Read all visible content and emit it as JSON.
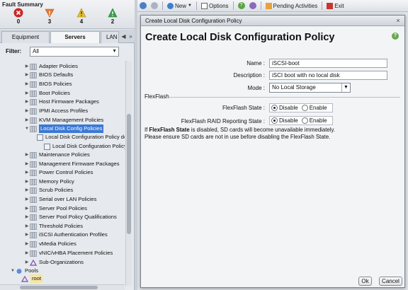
{
  "fault_summary": {
    "title": "Fault Summary",
    "counts": [
      {
        "name": "critical",
        "value": "0",
        "color": "#c62828"
      },
      {
        "name": "major",
        "value": "3",
        "color": "#e8772e"
      },
      {
        "name": "minor",
        "value": "4",
        "color": "#e6c02a"
      },
      {
        "name": "warning",
        "value": "2",
        "color": "#3aa04a"
      }
    ]
  },
  "nav_tabs": [
    "Equipment",
    "Servers",
    "LAN"
  ],
  "filter": {
    "label": "Filter:",
    "value": "All"
  },
  "tree": {
    "items": [
      "Adapter Policies",
      "BIOS Defaults",
      "BIOS Policies",
      "Boot Policies",
      "Host Firmware Packages",
      "IPMI Access Profiles",
      "KVM Management Policies",
      "Local Disk Config Policies",
      "Local Disk Configuration Policy default",
      "Local Disk Configuration Policy iSCSI-boot",
      "Maintenance Policies",
      "Management Firmware Packages",
      "Power Control Policies",
      "Memory Policy",
      "Scrub Policies",
      "Serial over LAN Policies",
      "Server Pool Policies",
      "Server Pool Policy Qualifications",
      "Threshold Policies",
      "iSCSI Authentication Profiles",
      "vMedia Policies",
      "vNIC/vHBA Placement Policies",
      "Sub-Organizations",
      "Pools",
      "root"
    ]
  },
  "toolbar": {
    "new_label": "New",
    "options_label": "Options",
    "pending_label": "Pending Activities",
    "exit_label": "Exit"
  },
  "dialog": {
    "window_title": "Create Local Disk Configuration Policy",
    "heading": "Create Local Disk Configuration Policy",
    "name_label": "Name :",
    "name_value": "iSCSI-boot",
    "description_label": "Description :",
    "description_value": "iSCI boot with no local disk",
    "mode_label": "Mode :",
    "mode_value": "No Local Storage",
    "flexflash_section": "FlexFlash",
    "ff_state_label": "FlexFlash State :",
    "ff_raid_label": "FlexFlash RAID Reporting State :",
    "opt_disable": "Disable",
    "opt_enable": "Enable",
    "note_prefix": "If ",
    "note_bold": "FlexFlash State",
    "note_rest": " is disabled, SD cards will become unavailable immediately.",
    "note_line2": "Please ensure SD cards are not in use before disabling the FlexFlash State.",
    "ok_label": "Ok",
    "cancel_label": "Cancel"
  }
}
